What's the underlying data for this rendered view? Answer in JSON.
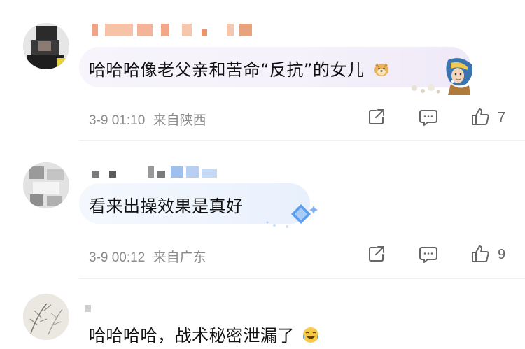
{
  "comments": [
    {
      "text": "哈哈哈像老父亲和苦命“反抗”的女儿",
      "emoji": "dog-face-emoji",
      "time": "3-9 01:10",
      "location": "来自陕西",
      "likes": "7",
      "bubble_style": "purple"
    },
    {
      "text": "看来出操效果是真好",
      "time": "3-9 00:12",
      "location": "来自广东",
      "likes": "9",
      "bubble_style": "blue"
    },
    {
      "text": "哈哈哈哈，战术秘密泄漏了",
      "emoji": "tears-of-joy-emoji"
    }
  ],
  "icons": {
    "share": "share-icon",
    "reply": "comment-icon",
    "like": "thumbs-up-icon"
  },
  "colors": {
    "meta_text": "#8a8a8a",
    "icon": "#666666",
    "bubble_purple": "#f5f2fb",
    "bubble_blue": "#eef4fd"
  }
}
